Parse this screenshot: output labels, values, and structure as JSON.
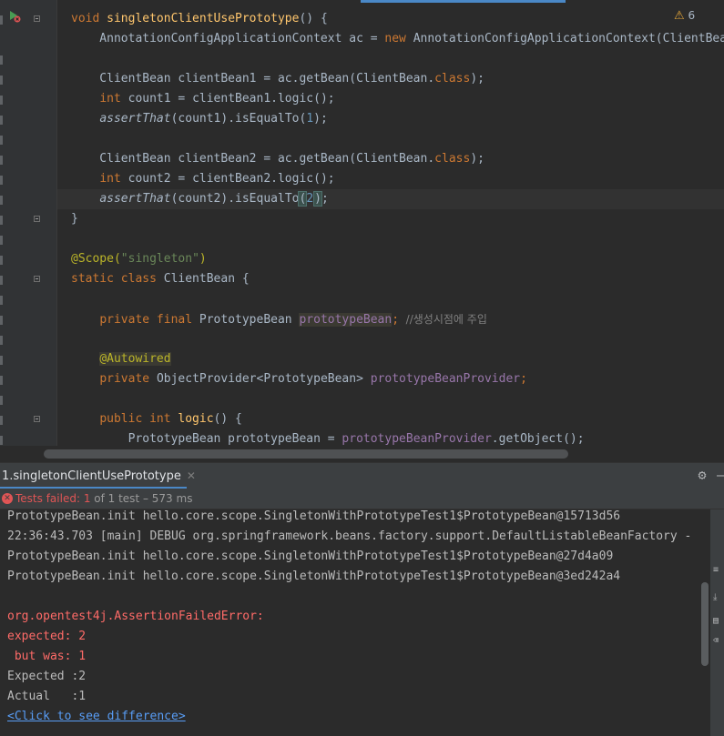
{
  "editor": {
    "warnings": {
      "count": "6"
    },
    "lines": {
      "l1": {
        "t0": "void ",
        "t1": "singletonClientUsePrototype",
        "t2": "() {"
      },
      "l2": {
        "t0": "    AnnotationConfigApplicationContext ac = ",
        "t1": "new ",
        "t2": "AnnotationConfigApplicationContext(ClientBean.class);"
      },
      "l4": {
        "t0": "    ClientBean clientBean1 = ac.getBean(ClientBean.",
        "t1": "class",
        "t2": ");"
      },
      "l5": {
        "t0": "    ",
        "t1": "int ",
        "t2": "count1 = clientBean1.logic();"
      },
      "l6": {
        "t0": "    ",
        "t1": "assertThat",
        "t2": "(count1).isEqualTo(",
        "t3": "1",
        "t4": ");"
      },
      "l8": {
        "t0": "    ClientBean clientBean2 = ac.getBean(ClientBean.",
        "t1": "class",
        "t2": ");"
      },
      "l9": {
        "t0": "    ",
        "t1": "int ",
        "t2": "count2 = clientBean2.logic();"
      },
      "l10": {
        "t0": "    ",
        "t1": "assertThat",
        "t2": "(count2).isEqualTo",
        "t3": "(",
        "t4": "2",
        "t5": ")",
        "t6": ";"
      },
      "l11": {
        "t0": "}"
      },
      "l13": {
        "t0": "@Scope(",
        "t1": "\"singleton\"",
        "t2": ")"
      },
      "l14": {
        "t0": "static class ",
        "t1": "ClientBean {"
      },
      "l16": {
        "t0": "    ",
        "t1": "private final ",
        "t2": "PrototypeBean ",
        "t3": "prototypeBean",
        "t4": ";",
        "t5": "  //생성시점에 주입"
      },
      "l18": {
        "t0": "    ",
        "t1": "@Autowired"
      },
      "l19": {
        "t0": "    ",
        "t1": "private ",
        "t2": "ObjectProvider<PrototypeBean> ",
        "t3": "prototypeBeanProvider",
        "t4": ";"
      },
      "l21": {
        "t0": "    ",
        "t1": "public int ",
        "t2": "logic",
        "t3": "() {"
      },
      "l22": {
        "t0": "        PrototypeBean prototypeBean = ",
        "t1": "prototypeBeanProvider",
        "t2": ".getObject();"
      }
    }
  },
  "run_panel": {
    "tab_label": "1.singletonClientUsePrototype",
    "status": {
      "label": "Tests failed: ",
      "count": "1",
      "of": " of 1 test",
      "duration": " – 573 ms"
    }
  },
  "console": {
    "lines": [
      "PrototypeBean.init hello.core.scope.SingletonWithPrototypeTest1$PrototypeBean@15713d56",
      "22:36:43.703 [main] DEBUG org.springframework.beans.factory.support.DefaultListableBeanFactory - Creating shared instance of singleton bean",
      "PrototypeBean.init hello.core.scope.SingletonWithPrototypeTest1$PrototypeBean@27d4a09",
      "PrototypeBean.init hello.core.scope.SingletonWithPrototypeTest1$PrototypeBean@3ed242a4",
      "",
      "org.opentest4j.AssertionFailedError:",
      "expected: 2",
      " but was: 1",
      "Expected :2",
      "Actual   :1",
      "<Click to see difference>"
    ]
  },
  "colors": {
    "error": "#ff6b68",
    "link": "#589df6",
    "keyword": "#cc7832",
    "function": "#ffc66d",
    "string": "#6a8759",
    "number": "#6897bb",
    "field": "#9876aa"
  }
}
